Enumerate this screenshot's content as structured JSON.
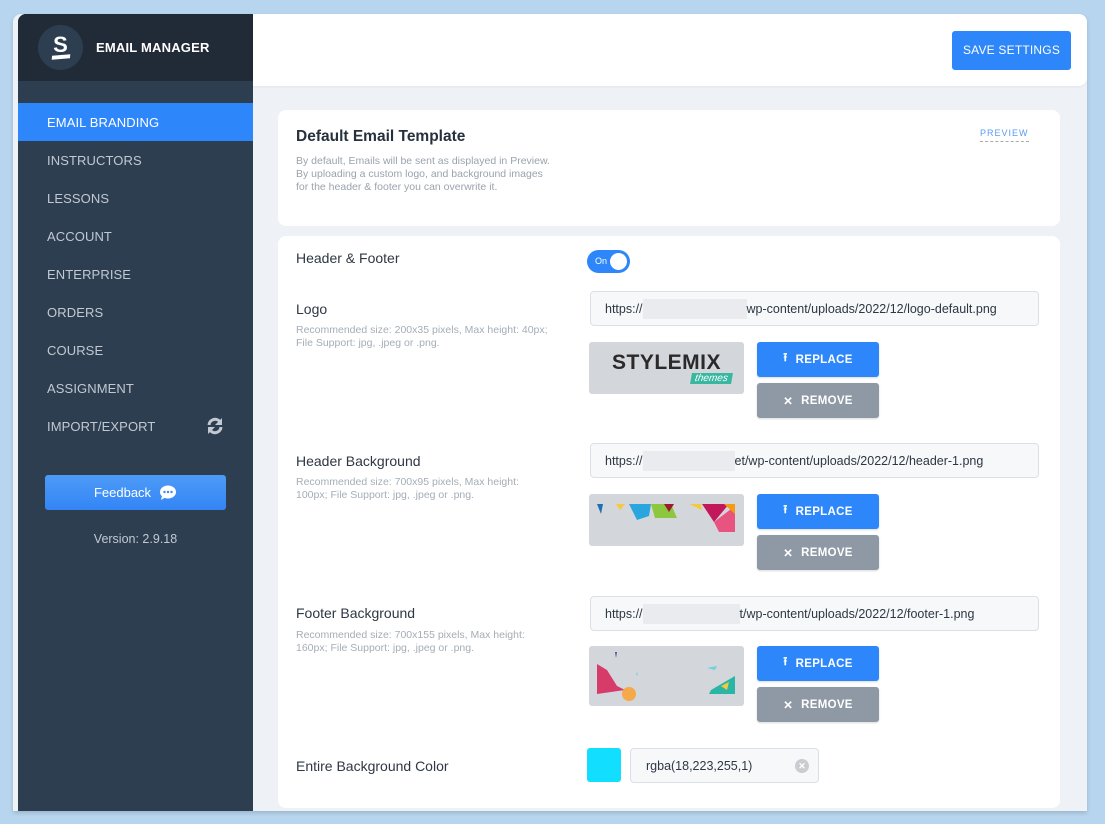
{
  "sidebar": {
    "app_title": "EMAIL MANAGER",
    "logo_icon": "stylemix-s-logo",
    "items": [
      {
        "label": "EMAIL BRANDING",
        "active": true
      },
      {
        "label": "INSTRUCTORS",
        "active": false
      },
      {
        "label": "LESSONS",
        "active": false
      },
      {
        "label": "ACCOUNT",
        "active": false
      },
      {
        "label": "ENTERPRISE",
        "active": false
      },
      {
        "label": "ORDERS",
        "active": false
      },
      {
        "label": "COURSE",
        "active": false
      },
      {
        "label": "ASSIGNMENT",
        "active": false
      },
      {
        "label": "IMPORT/EXPORT",
        "active": false,
        "icon": "sync-icon"
      }
    ],
    "feedback_label": "Feedback",
    "feedback_icon": "chat-bubble-icon",
    "version": "Version: 2.9.18"
  },
  "topbar": {
    "save_label": "SAVE SETTINGS"
  },
  "template_card": {
    "title": "Default Email Template",
    "description": "By default, Emails will be sent as displayed in Preview. By uploading a custom logo, and background images for the header & footer you can overwrite it.",
    "preview_label": "PREVIEW"
  },
  "settings": {
    "header_footer": {
      "label": "Header & Footer",
      "toggle_text": "On",
      "enabled": true
    },
    "logo": {
      "label": "Logo",
      "description": "Recommended size: 200x35 pixels, Max height: 40px; File Support: jpg, .jpeg or .png.",
      "url_prefix": "https://",
      "url_suffix": "wp-content/uploads/2022/12/logo-default.png",
      "thumb_text": "STYLEMIX",
      "thumb_subtext": "themes",
      "replace_label": "REPLACE",
      "remove_label": "REMOVE"
    },
    "header_background": {
      "label": "Header Background",
      "description": "Recommended size: 700x95 pixels, Max height: 100px; File Support: jpg, .jpeg or .png.",
      "url_prefix": "https://",
      "url_suffix": "et/wp-content/uploads/2022/12/header-1.png",
      "replace_label": "REPLACE",
      "remove_label": "REMOVE"
    },
    "footer_background": {
      "label": "Footer Background",
      "description": "Recommended size: 700x155 pixels, Max height: 160px; File Support: jpg, .jpeg or .png.",
      "url_prefix": "https://",
      "url_suffix": "t/wp-content/uploads/2022/12/footer-1.png",
      "replace_label": "REPLACE",
      "remove_label": "REMOVE"
    },
    "background_color": {
      "label": "Entire Background Color",
      "value": "rgba(18,223,255,1)",
      "swatch": "#12dfff"
    }
  },
  "colors": {
    "accent": "#2d87fb",
    "sidebar_bg": "#2d3e50",
    "sidebar_head_bg": "#212b37",
    "remove_button": "#8e99a5"
  }
}
